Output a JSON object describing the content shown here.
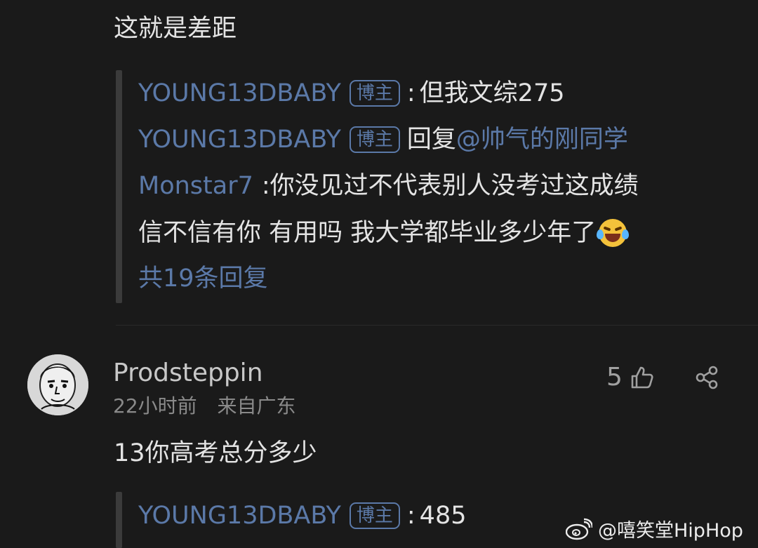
{
  "comment1": {
    "text": "这就是差距",
    "replies": [
      {
        "author": "YOUNG13DBABY",
        "badge": "博主",
        "separator": ":",
        "text": "但我文综275"
      },
      {
        "author": "YOUNG13DBABY",
        "badge": "博主",
        "text_prefix": "回复",
        "mention": "@帅气的刚同学"
      },
      {
        "author": "Monstar7",
        "separator": ":",
        "text": "你没见过不代表别人没考过这成绩"
      }
    ],
    "continued_text": "信不信有你 有用吗 我大学都毕业多少年了",
    "more_replies_label": "共19条回复"
  },
  "comment2": {
    "username": "Prodsteppin",
    "time": "22小时前",
    "location": "来自广东",
    "likes": "5",
    "text": "13你高考总分多少",
    "reply": {
      "author": "YOUNG13DBABY",
      "badge": "博主",
      "separator": ":",
      "text": "485"
    }
  },
  "watermark": {
    "text": "@嘻笑堂HipHop"
  },
  "colors": {
    "background": "#1a1a1a",
    "accent_blue": "#5b79a8",
    "text_primary": "#e4e4e4",
    "text_muted": "#8a8a8a"
  },
  "icons": {
    "like": "thumbs-up-icon",
    "share": "share-icon",
    "emoji": "tears-of-joy-emoji",
    "watermark_logo": "weibo-logo"
  }
}
